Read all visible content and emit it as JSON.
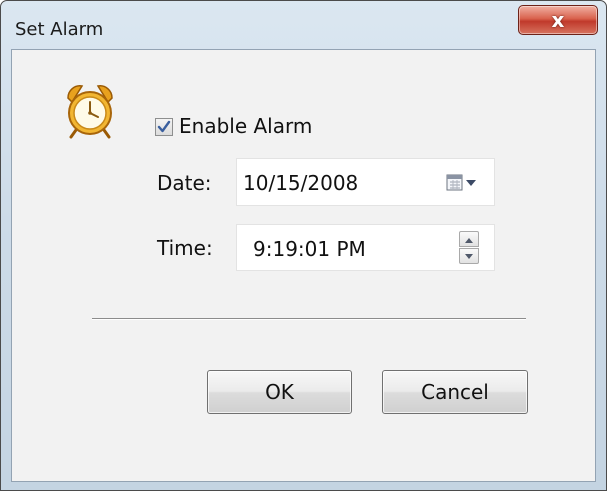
{
  "window": {
    "title": "Set Alarm",
    "close_label": "x"
  },
  "alarm": {
    "icon": "alarm-clock-icon",
    "enable_label": "Enable Alarm",
    "enabled": true
  },
  "date": {
    "label": "Date:",
    "value": "10/15/2008",
    "picker_icon": "calendar-icon"
  },
  "time": {
    "label": "Time:",
    "value": "9:19:01 PM",
    "spinner_icons": [
      "spin-up-icon",
      "spin-down-icon"
    ]
  },
  "buttons": {
    "ok": "OK",
    "cancel": "Cancel"
  },
  "colors": {
    "close_button": "#c0392b",
    "clock_body": "#f2b632",
    "check_mark": "#3a5f9e"
  }
}
